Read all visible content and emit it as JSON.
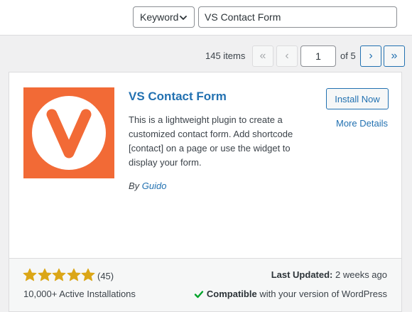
{
  "filter": {
    "type_value": "Keyword",
    "search_value": "VS Contact Form"
  },
  "pagination": {
    "items_count": "145 items",
    "first": "«",
    "prev": "‹",
    "current_page": "1",
    "of_label": "of 5",
    "next": "›",
    "last": "»"
  },
  "plugin": {
    "name": "VS Contact Form",
    "icon": "vs-contact-form-logo",
    "install_label": "Install Now",
    "more_details_label": "More Details",
    "description": "This is a lightweight plugin to create a customized contact form. Add shortcode [contact] on a page or use the widget to display your form.",
    "by_label": "By",
    "author": "Guido",
    "rating": 5,
    "rating_max": 5,
    "rating_count": "(45)",
    "active_installs": "10,000+ Active Installations",
    "last_updated_label": "Last Updated:",
    "last_updated_value": "2 weeks ago",
    "compatible_label": "Compatible",
    "compatible_text": "with your version of WordPress"
  },
  "colors": {
    "accent": "#2271b1",
    "icon_bg": "#f26a36",
    "star": "#dba617",
    "check": "#00a32a"
  }
}
